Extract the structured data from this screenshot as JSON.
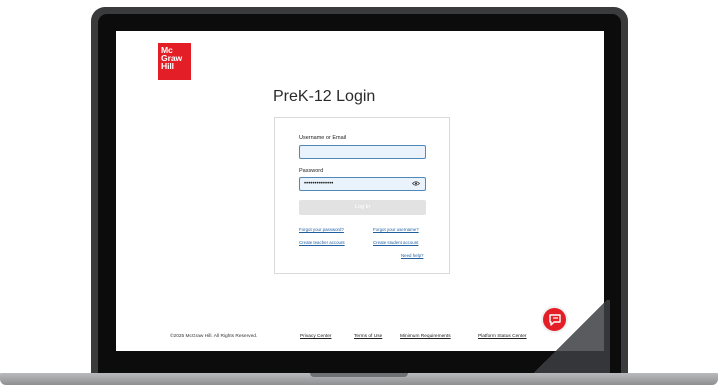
{
  "brand": {
    "logo_lines": [
      "Mc",
      "Graw",
      "Hill"
    ]
  },
  "page": {
    "title": "PreK-12 Login"
  },
  "form": {
    "username_label": "Username or Email",
    "username_value": "",
    "password_label": "Password",
    "password_value": "••••••••••••••",
    "login_label": "Log In"
  },
  "links": {
    "forgot_password": "Forgot your password?",
    "forgot_username": "Forgot your username?",
    "create_teacher": "Create teacher account",
    "create_student": "Create student account",
    "need_help": "Need help?"
  },
  "footer": {
    "copyright": "©2025 McGraw Hill. All Rights Reserved.",
    "privacy": "Privacy Center",
    "terms": "Terms of Use",
    "requirements": "Minimum Requirements",
    "status": "Platform Status Center"
  },
  "colors": {
    "brand_red": "#e41e26",
    "field_border": "#4d88b8",
    "link_blue": "#1f5fa0",
    "button_disabled": "#e2e2e2"
  },
  "icons": {
    "password_toggle": "eye-icon",
    "chat": "chat-bubble-icon"
  }
}
